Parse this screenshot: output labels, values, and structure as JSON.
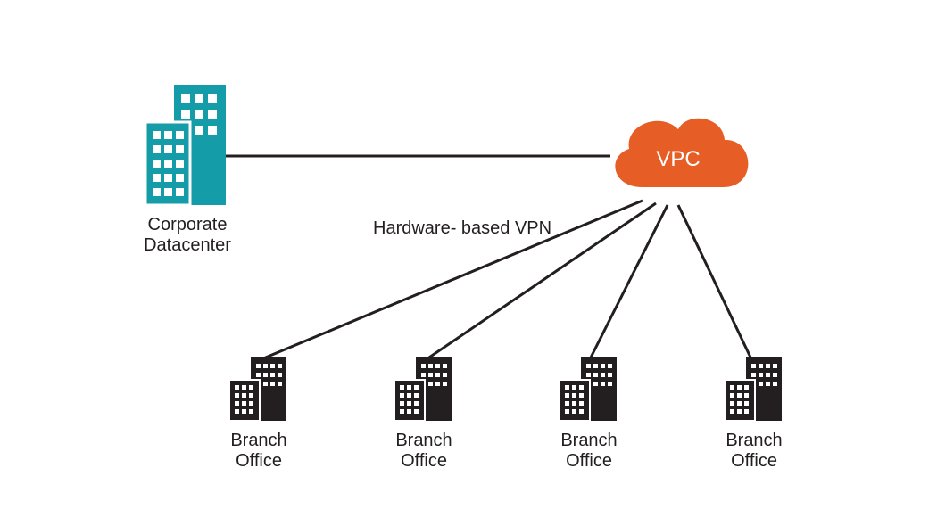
{
  "diagram": {
    "datacenter_label": "Corporate\nDatacenter",
    "cloud_label": "VPC",
    "vpn_label": "Hardware-\nbased VPN",
    "branches": [
      {
        "label": "Branch\nOffice"
      },
      {
        "label": "Branch\nOffice"
      },
      {
        "label": "Branch\nOffice"
      },
      {
        "label": "Branch\nOffice"
      }
    ],
    "colors": {
      "datacenter": "#149da8",
      "cloud": "#e65d25",
      "line": "#231f20",
      "branch": "#231f20"
    }
  }
}
